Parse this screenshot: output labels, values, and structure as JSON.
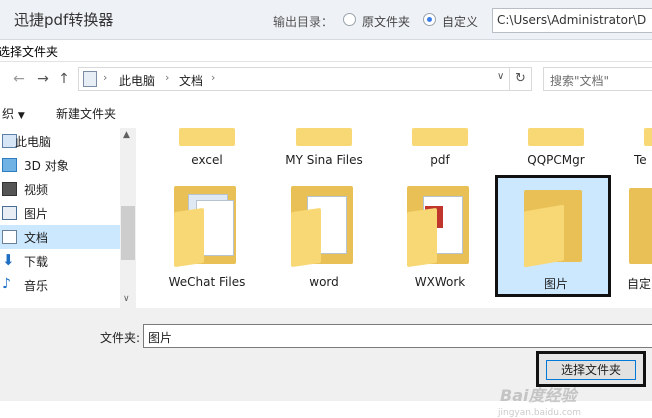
{
  "app": {
    "title": "迅捷pdf转换器",
    "output_label": "输出目录：",
    "radio_source": "原文件夹",
    "radio_custom": "自定义",
    "custom_selected": true,
    "path_value": "C:\\Users\\Administrator\\D"
  },
  "dialog": {
    "title": "选择文件夹",
    "nav": {
      "back": "←",
      "forward": "→",
      "recent": "∨",
      "up": "↑",
      "refresh": "↻"
    },
    "breadcrumb": [
      "此电脑",
      "文档"
    ],
    "search_placeholder": "搜索\"文档\"",
    "toolbar": {
      "organize": "织",
      "new_folder": "新建文件夹"
    },
    "sidebar": [
      {
        "label": "此电脑",
        "icon": "computer-icon"
      },
      {
        "label": "3D 对象",
        "icon": "cube-icon"
      },
      {
        "label": "视频",
        "icon": "video-icon"
      },
      {
        "label": "图片",
        "icon": "picture-icon"
      },
      {
        "label": "文档",
        "icon": "document-icon",
        "selected": true
      },
      {
        "label": "下载",
        "icon": "download-icon"
      },
      {
        "label": "音乐",
        "icon": "music-icon"
      }
    ],
    "folders_row1": [
      "excel",
      "MY Sina Files",
      "pdf",
      "QQPCMgr",
      "Te"
    ],
    "folders_row2": [
      "WeChat Files",
      "word",
      "WXWork",
      "图片",
      "自定"
    ],
    "selected_folder": "图片",
    "folder_label": "文件夹:",
    "folder_value": "图片",
    "select_button": "选择文件夹",
    "watermark": "Bai度经验",
    "watermark_url": "jingyan.baidu.com"
  }
}
